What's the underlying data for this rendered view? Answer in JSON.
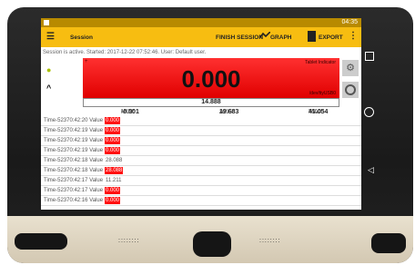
{
  "statusbar": {
    "time": "04:35",
    "bt_icon": "bluetooth-icon",
    "battery_icon": "battery-icon"
  },
  "appbar": {
    "title": "Session",
    "finish_label": "FINISH SESSION",
    "graph_label": "GRAPH",
    "export_label": "EXPORT"
  },
  "session_info": "Session is active. Started: 2017-12-22 07:52:46. User: Default user.",
  "indicator": {
    "label": "Tablet Indicator",
    "value": "0.000",
    "device": "/dev/ttyUSB0",
    "plus": "+",
    "sub_value": "14.888"
  },
  "stats": {
    "min_label": "MIN:",
    "min": "-0.001",
    "avg_label": "AVG:",
    "avg": "19.683",
    "max_label": "MAX:",
    "max": "41.054"
  },
  "log": [
    {
      "time": "Time-52370:42:20",
      "label": "Value",
      "value": "0.000",
      "alarm": true
    },
    {
      "time": "Time-52370:42:19",
      "label": "Value",
      "value": "0.000",
      "alarm": true
    },
    {
      "time": "Time-52370:42:19",
      "label": "Value",
      "value": "0.000",
      "alarm": true
    },
    {
      "time": "Time-52370:42:19",
      "label": "Value",
      "value": "0.000",
      "alarm": true
    },
    {
      "time": "Time-52370:42:18",
      "label": "Value",
      "value": "28.088",
      "alarm": false
    },
    {
      "time": "Time-52370:42:18",
      "label": "Value",
      "value": "28.088",
      "alarm": true
    },
    {
      "time": "Time-52370:42:17",
      "label": "Value",
      "value": "11.211",
      "alarm": false
    },
    {
      "time": "Time-52370:42:17",
      "label": "Value",
      "value": "0.000",
      "alarm": true
    },
    {
      "time": "Time-52370:42:16",
      "label": "Value",
      "value": "0.000",
      "alarm": true
    }
  ],
  "colors": {
    "appbar": "#f7bd11",
    "statusbar": "#b88a00",
    "indicator": "#ff2020",
    "alarm": "#ff1010"
  }
}
